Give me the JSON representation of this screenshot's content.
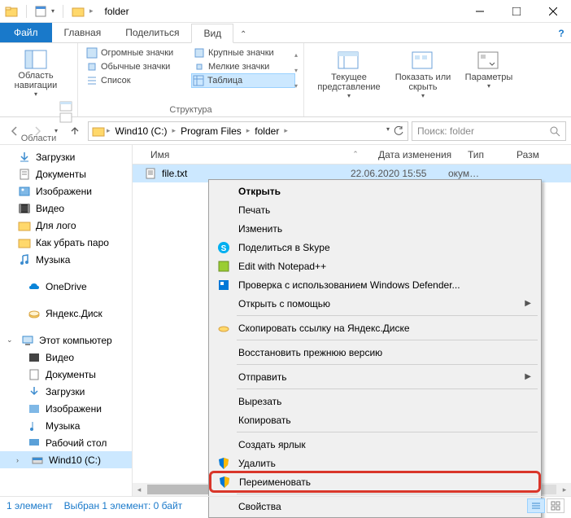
{
  "titlebar": {
    "title": "folder"
  },
  "tabs": {
    "file": "Файл",
    "home": "Главная",
    "share": "Поделиться",
    "view": "Вид"
  },
  "ribbon": {
    "areas": {
      "nav_label": "Область навигации",
      "group_label": "Области"
    },
    "layout": {
      "huge": "Огромные значки",
      "large": "Крупные значки",
      "normal": "Обычные значки",
      "small": "Мелкие значки",
      "list": "Список",
      "table": "Таблица",
      "group_label": "Структура"
    },
    "current": {
      "current_view": "Текущее представление",
      "show_hide": "Показать или скрыть",
      "options": "Параметры"
    }
  },
  "breadcrumb": {
    "items": [
      "Wind10 (C:)",
      "Program Files",
      "folder"
    ]
  },
  "search": {
    "placeholder": "Поиск: folder"
  },
  "sidebar": {
    "items": [
      {
        "label": "Загрузки"
      },
      {
        "label": "Документы"
      },
      {
        "label": "Изображени"
      },
      {
        "label": "Видео"
      },
      {
        "label": "Для лого"
      },
      {
        "label": "Как убрать паро"
      },
      {
        "label": "Музыка"
      }
    ],
    "onedrive": "OneDrive",
    "yandex": "Яндекс.Диск",
    "thispc": "Этот компьютер",
    "thispc_children": [
      "Видео",
      "Документы",
      "Загрузки",
      "Изображени",
      "Музыка",
      "Рабочий стол"
    ],
    "drive": "Wind10 (C:)"
  },
  "columns": {
    "name": "Имя",
    "date": "Дата изменения",
    "type": "Тип",
    "size": "Разм"
  },
  "file": {
    "name": "file.txt",
    "date": "22.06.2020 15:55",
    "type": "окум…"
  },
  "ctx": {
    "open": "Открыть",
    "print": "Печать",
    "edit": "Изменить",
    "skype": "Поделиться в Skype",
    "notepad": "Edit with Notepad++",
    "defender": "Проверка с использованием Windows Defender...",
    "openwith": "Открыть с помощью",
    "yandex_copy": "Скопировать ссылку на Яндекс.Диске",
    "restore": "Восстановить прежнюю версию",
    "sendto": "Отправить",
    "cut": "Вырезать",
    "copy": "Копировать",
    "shortcut": "Создать ярлык",
    "delete": "Удалить",
    "rename": "Переименовать",
    "props": "Свойства"
  },
  "status": {
    "left": "1 элемент",
    "mid": "Выбран 1 элемент: 0 байт"
  }
}
